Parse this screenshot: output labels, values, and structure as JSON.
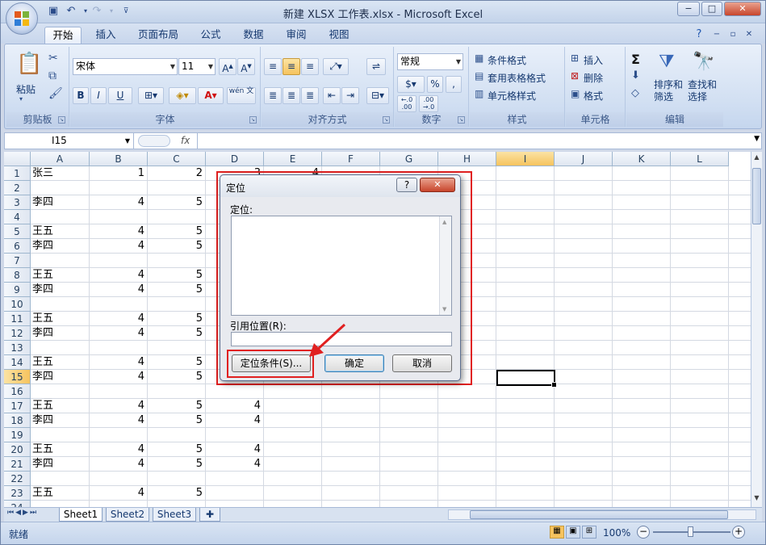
{
  "window": {
    "title": "新建 XLSX 工作表.xlsx - Microsoft Excel",
    "minimize": "−",
    "maximize": "□",
    "close": "✕"
  },
  "ribbon_tabs": [
    "开始",
    "插入",
    "页面布局",
    "公式",
    "数据",
    "审阅",
    "视图"
  ],
  "ribbon": {
    "clipboard": {
      "paste": "粘贴",
      "label": "剪贴板"
    },
    "font": {
      "name": "宋体",
      "size": "11",
      "label": "字体",
      "bold": "B",
      "italic": "I",
      "underline": "U",
      "phonetic": "wén 文"
    },
    "alignment": {
      "label": "对齐方式"
    },
    "number": {
      "format": "常规",
      "percent": "%",
      "comma": ",",
      "label": "数字"
    },
    "styles": {
      "conditional": "条件格式",
      "table": "套用表格格式",
      "cell": "单元格样式",
      "label": "样式"
    },
    "cells": {
      "insert": "插入",
      "delete": "删除",
      "format": "格式",
      "label": "单元格"
    },
    "editing": {
      "sort": "排序和\n筛选",
      "find": "查找和\n选择",
      "label": "编辑"
    }
  },
  "formula_bar": {
    "name_box": "I15",
    "fx": "fx",
    "formula": ""
  },
  "columns": [
    "A",
    "B",
    "C",
    "D",
    "E",
    "F",
    "G",
    "H",
    "I",
    "J",
    "K",
    "L"
  ],
  "selected_column": "I",
  "rows": [
    {
      "n": "1",
      "a": "张三",
      "b": "1",
      "c": "2",
      "d": "3",
      "e": "4"
    },
    {
      "n": "2",
      "a": "",
      "b": "",
      "c": "",
      "d": "",
      "e": ""
    },
    {
      "n": "3",
      "a": "李四",
      "b": "4",
      "c": "5",
      "d": "",
      "e": ""
    },
    {
      "n": "4",
      "a": "",
      "b": "",
      "c": "",
      "d": "",
      "e": ""
    },
    {
      "n": "5",
      "a": "王五",
      "b": "4",
      "c": "5",
      "d": "",
      "e": ""
    },
    {
      "n": "6",
      "a": "李四",
      "b": "4",
      "c": "5",
      "d": "",
      "e": ""
    },
    {
      "n": "7",
      "a": "",
      "b": "",
      "c": "",
      "d": "",
      "e": ""
    },
    {
      "n": "8",
      "a": "王五",
      "b": "4",
      "c": "5",
      "d": "",
      "e": ""
    },
    {
      "n": "9",
      "a": "李四",
      "b": "4",
      "c": "5",
      "d": "",
      "e": ""
    },
    {
      "n": "10",
      "a": "",
      "b": "",
      "c": "",
      "d": "",
      "e": ""
    },
    {
      "n": "11",
      "a": "王五",
      "b": "4",
      "c": "5",
      "d": "",
      "e": ""
    },
    {
      "n": "12",
      "a": "李四",
      "b": "4",
      "c": "5",
      "d": "",
      "e": ""
    },
    {
      "n": "13",
      "a": "",
      "b": "",
      "c": "",
      "d": "",
      "e": ""
    },
    {
      "n": "14",
      "a": "王五",
      "b": "4",
      "c": "5",
      "d": "",
      "e": ""
    },
    {
      "n": "15",
      "a": "李四",
      "b": "4",
      "c": "5",
      "d": "",
      "e": ""
    },
    {
      "n": "16",
      "a": "",
      "b": "",
      "c": "",
      "d": "",
      "e": ""
    },
    {
      "n": "17",
      "a": "王五",
      "b": "4",
      "c": "5",
      "d": "4",
      "e": ""
    },
    {
      "n": "18",
      "a": "李四",
      "b": "4",
      "c": "5",
      "d": "4",
      "e": ""
    },
    {
      "n": "19",
      "a": "",
      "b": "",
      "c": "",
      "d": "",
      "e": ""
    },
    {
      "n": "20",
      "a": "王五",
      "b": "4",
      "c": "5",
      "d": "4",
      "e": ""
    },
    {
      "n": "21",
      "a": "李四",
      "b": "4",
      "c": "5",
      "d": "4",
      "e": ""
    },
    {
      "n": "22",
      "a": "",
      "b": "",
      "c": "",
      "d": "",
      "e": ""
    },
    {
      "n": "23",
      "a": "王五",
      "b": "4",
      "c": "5",
      "d": "",
      "e": ""
    },
    {
      "n": "24",
      "a": "",
      "b": "",
      "c": "",
      "d": "",
      "e": ""
    }
  ],
  "selected_row": "15",
  "sheets": [
    "Sheet1",
    "Sheet2",
    "Sheet3"
  ],
  "active_sheet": "Sheet1",
  "status": {
    "ready": "就绪",
    "zoom": "100%"
  },
  "dialog": {
    "title": "定位",
    "help": "?",
    "close": "✕",
    "goto_label": "定位:",
    "reference_label": "引用位置(R):",
    "reference_value": "",
    "special_button": "定位条件(S)...",
    "ok_button": "确定",
    "cancel_button": "取消"
  },
  "colors": {
    "highlight": "#e02020",
    "selection": "#f6c35e",
    "ribbon": "#d1dff2"
  }
}
